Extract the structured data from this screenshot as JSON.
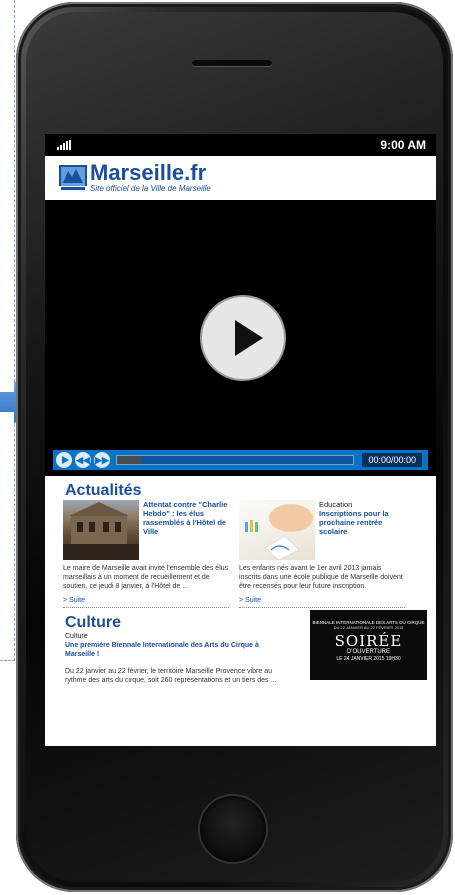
{
  "statusbar": {
    "time": "9:00 AM"
  },
  "site": {
    "title": "Marseille.fr",
    "subtitle": "Site officiel de la Ville de Marseille"
  },
  "video": {
    "time_display": "00:00/00:00",
    "progress_buffered": 0.1
  },
  "actualites": {
    "title": "Actualités",
    "items": [
      {
        "category": "",
        "headline": "Attentat contre \"Charlie Hebdo\" : les élus rassemblés à l'Hôtel de Ville",
        "body": "Le maire de Marseille avait invité l'ensemble des élus marseillais à un moment de recueillement et de soutien, ce jeudi 8 janvier, à l'Hôtel de ...",
        "link": "> Suite"
      },
      {
        "category": "Education",
        "headline": "Inscriptions pour la prochaine rentrée scolaire",
        "body": "Les enfants nés avant le 1er avril 2013 jamais inscrits dans une école publique de Marseille doivent être recensés pour leur future inscription.",
        "link": "> Suite"
      }
    ]
  },
  "culture": {
    "title": "Culture",
    "category": "Culture",
    "headline": "Une première Biennale Internationale des Arts du Cirque à Marseille !",
    "body": "Du 22 janvier au 22 février, le territoire Marseille Provence vibre au rythme des arts du cirque, soit 260 représentations et un tiers des ...",
    "poster": {
      "line1": "BIENNALE INTERNATIONALE DES ARTS DU CIRQUE",
      "line2": "DU 22 JANVIER AU 22 FÉVRIER 2015",
      "line3": "SOIRÉE",
      "line4": "D'OUVERTURE",
      "line5": "LE 24 JANVIER 2015 19H30"
    }
  },
  "colors": {
    "brand": "#1b4f9c",
    "player_bar": "#0a74c4"
  }
}
